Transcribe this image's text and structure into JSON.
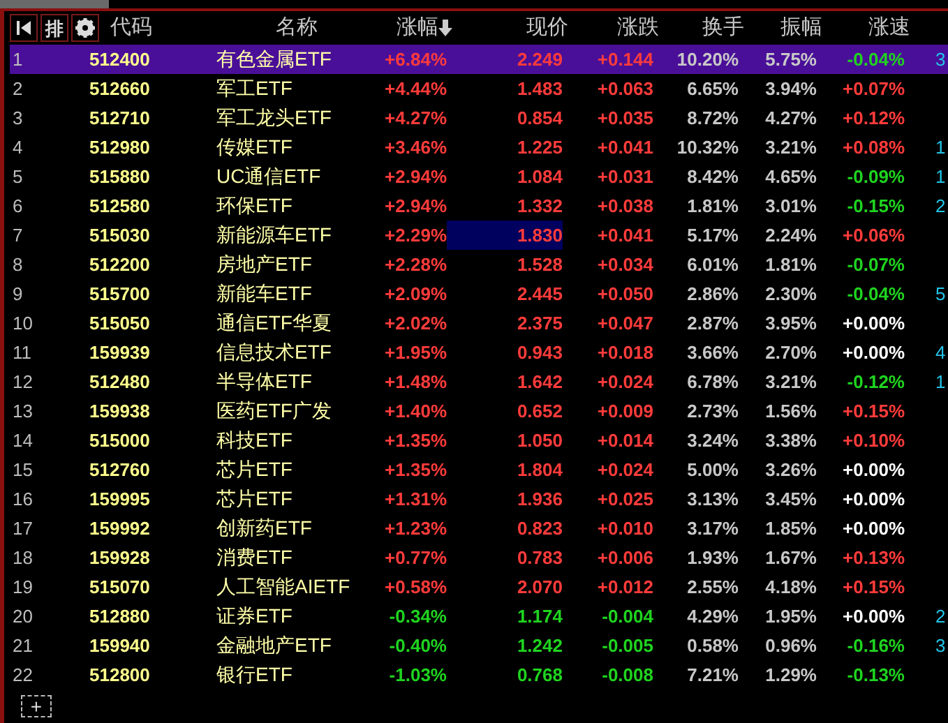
{
  "toolbar": {
    "sort_button": "排"
  },
  "columns": [
    {
      "label": "代码",
      "sorted_desc": false
    },
    {
      "label": "名称",
      "sorted_desc": false
    },
    {
      "label": "涨幅",
      "sorted_desc": true
    },
    {
      "label": "现价",
      "sorted_desc": false
    },
    {
      "label": "涨跌",
      "sorted_desc": false
    },
    {
      "label": "换手",
      "sorted_desc": false
    },
    {
      "label": "振幅",
      "sorted_desc": false
    },
    {
      "label": "涨速",
      "sorted_desc": false
    }
  ],
  "rows": [
    {
      "num": "1",
      "code": "512400",
      "name": "有色金属ETF",
      "pct": "+6.84%",
      "price": "2.249",
      "change": "+0.144",
      "turnover": "10.20%",
      "amplitude": "5.75%",
      "speed": "-0.04%",
      "rising": true,
      "speed_rising": false,
      "speed_falling": true,
      "column_9": "3",
      "selected": true,
      "price_focused": false
    },
    {
      "num": "2",
      "code": "512660",
      "name": "军工ETF",
      "pct": "+4.44%",
      "price": "1.483",
      "change": "+0.063",
      "turnover": "6.65%",
      "amplitude": "3.94%",
      "speed": "+0.07%",
      "rising": true,
      "speed_rising": true,
      "speed_falling": false,
      "selected": false,
      "price_focused": false
    },
    {
      "num": "3",
      "code": "512710",
      "name": "军工龙头ETF",
      "pct": "+4.27%",
      "price": "0.854",
      "change": "+0.035",
      "turnover": "8.72%",
      "amplitude": "4.27%",
      "speed": "+0.12%",
      "rising": true,
      "speed_rising": true,
      "speed_falling": false,
      "selected": false,
      "price_focused": false
    },
    {
      "num": "4",
      "code": "512980",
      "name": "传媒ETF",
      "pct": "+3.46%",
      "price": "1.225",
      "change": "+0.041",
      "turnover": "10.32%",
      "amplitude": "3.21%",
      "speed": "+0.08%",
      "rising": true,
      "speed_rising": true,
      "speed_falling": false,
      "column_9": "1",
      "selected": false,
      "price_focused": false
    },
    {
      "num": "5",
      "code": "515880",
      "name": "UC通信ETF",
      "pct": "+2.94%",
      "price": "1.084",
      "change": "+0.031",
      "turnover": "8.42%",
      "amplitude": "4.65%",
      "speed": "-0.09%",
      "rising": true,
      "speed_rising": false,
      "speed_falling": true,
      "column_9": "1",
      "selected": false,
      "price_focused": false
    },
    {
      "num": "6",
      "code": "512580",
      "name": "环保ETF",
      "pct": "+2.94%",
      "price": "1.332",
      "change": "+0.038",
      "turnover": "1.81%",
      "amplitude": "3.01%",
      "speed": "-0.15%",
      "rising": true,
      "speed_rising": false,
      "speed_falling": true,
      "column_9": "2",
      "selected": false,
      "price_focused": false
    },
    {
      "num": "7",
      "code": "515030",
      "name": "新能源车ETF",
      "pct": "+2.29%",
      "price": "1.830",
      "change": "+0.041",
      "turnover": "5.17%",
      "amplitude": "2.24%",
      "speed": "+0.06%",
      "rising": true,
      "speed_rising": true,
      "speed_falling": false,
      "selected": false,
      "price_focused": true
    },
    {
      "num": "8",
      "code": "512200",
      "name": "房地产ETF",
      "pct": "+2.28%",
      "price": "1.528",
      "change": "+0.034",
      "turnover": "6.01%",
      "amplitude": "1.81%",
      "speed": "-0.07%",
      "rising": true,
      "speed_rising": false,
      "speed_falling": true,
      "selected": false,
      "price_focused": false
    },
    {
      "num": "9",
      "code": "515700",
      "name": "新能车ETF",
      "pct": "+2.09%",
      "price": "2.445",
      "change": "+0.050",
      "turnover": "2.86%",
      "amplitude": "2.30%",
      "speed": "-0.04%",
      "rising": true,
      "speed_rising": false,
      "speed_falling": true,
      "column_9": "5",
      "selected": false,
      "price_focused": false
    },
    {
      "num": "10",
      "code": "515050",
      "name": "通信ETF华夏",
      "pct": "+2.02%",
      "price": "2.375",
      "change": "+0.047",
      "turnover": "2.87%",
      "amplitude": "3.95%",
      "speed": "+0.00%",
      "rising": true,
      "speed_rising": false,
      "speed_falling": false,
      "selected": false,
      "price_focused": false
    },
    {
      "num": "11",
      "code": "159939",
      "name": "信息技术ETF",
      "pct": "+1.95%",
      "price": "0.943",
      "change": "+0.018",
      "turnover": "3.66%",
      "amplitude": "2.70%",
      "speed": "+0.00%",
      "rising": true,
      "speed_rising": false,
      "speed_falling": false,
      "column_9": "4",
      "selected": false,
      "price_focused": false
    },
    {
      "num": "12",
      "code": "512480",
      "name": "半导体ETF",
      "pct": "+1.48%",
      "price": "1.642",
      "change": "+0.024",
      "turnover": "6.78%",
      "amplitude": "3.21%",
      "speed": "-0.12%",
      "rising": true,
      "speed_rising": false,
      "speed_falling": true,
      "column_9": "1",
      "selected": false,
      "price_focused": false
    },
    {
      "num": "13",
      "code": "159938",
      "name": "医药ETF广发",
      "pct": "+1.40%",
      "price": "0.652",
      "change": "+0.009",
      "turnover": "2.73%",
      "amplitude": "1.56%",
      "speed": "+0.15%",
      "rising": true,
      "speed_rising": true,
      "speed_falling": false,
      "selected": false,
      "price_focused": false
    },
    {
      "num": "14",
      "code": "515000",
      "name": "科技ETF",
      "pct": "+1.35%",
      "price": "1.050",
      "change": "+0.014",
      "turnover": "3.24%",
      "amplitude": "3.38%",
      "speed": "+0.10%",
      "rising": true,
      "speed_rising": true,
      "speed_falling": false,
      "selected": false,
      "price_focused": false
    },
    {
      "num": "15",
      "code": "512760",
      "name": "芯片ETF",
      "pct": "+1.35%",
      "price": "1.804",
      "change": "+0.024",
      "turnover": "5.00%",
      "amplitude": "3.26%",
      "speed": "+0.00%",
      "rising": true,
      "speed_rising": false,
      "speed_falling": false,
      "selected": false,
      "price_focused": false
    },
    {
      "num": "16",
      "code": "159995",
      "name": "芯片ETF",
      "pct": "+1.31%",
      "price": "1.936",
      "change": "+0.025",
      "turnover": "3.13%",
      "amplitude": "3.45%",
      "speed": "+0.00%",
      "rising": true,
      "speed_rising": false,
      "speed_falling": false,
      "selected": false,
      "price_focused": false
    },
    {
      "num": "17",
      "code": "159992",
      "name": "创新药ETF",
      "pct": "+1.23%",
      "price": "0.823",
      "change": "+0.010",
      "turnover": "3.17%",
      "amplitude": "1.85%",
      "speed": "+0.00%",
      "rising": true,
      "speed_rising": false,
      "speed_falling": false,
      "selected": false,
      "price_focused": false
    },
    {
      "num": "18",
      "code": "159928",
      "name": "消费ETF",
      "pct": "+0.77%",
      "price": "0.783",
      "change": "+0.006",
      "turnover": "1.93%",
      "amplitude": "1.67%",
      "speed": "+0.13%",
      "rising": true,
      "speed_rising": true,
      "speed_falling": false,
      "selected": false,
      "price_focused": false
    },
    {
      "num": "19",
      "code": "515070",
      "name": "人工智能AIETF",
      "pct": "+0.58%",
      "price": "2.070",
      "change": "+0.012",
      "turnover": "2.55%",
      "amplitude": "4.18%",
      "speed": "+0.15%",
      "rising": true,
      "speed_rising": true,
      "speed_falling": false,
      "selected": false,
      "price_focused": false
    },
    {
      "num": "20",
      "code": "512880",
      "name": "证券ETF",
      "pct": "-0.34%",
      "price": "1.174",
      "change": "-0.004",
      "turnover": "4.29%",
      "amplitude": "1.95%",
      "speed": "+0.00%",
      "rising": false,
      "speed_rising": false,
      "speed_falling": false,
      "column_9": "2",
      "selected": false,
      "price_focused": false
    },
    {
      "num": "21",
      "code": "159940",
      "name": "金融地产ETF",
      "pct": "-0.40%",
      "price": "1.242",
      "change": "-0.005",
      "turnover": "0.58%",
      "amplitude": "0.96%",
      "speed": "-0.16%",
      "rising": false,
      "speed_rising": false,
      "speed_falling": true,
      "column_9": "3",
      "selected": false,
      "price_focused": false
    },
    {
      "num": "22",
      "code": "512800",
      "name": "银行ETF",
      "pct": "-1.03%",
      "price": "0.768",
      "change": "-0.008",
      "turnover": "7.21%",
      "amplitude": "1.29%",
      "speed": "-0.13%",
      "rising": false,
      "speed_rising": false,
      "speed_falling": true,
      "selected": false,
      "price_focused": false
    }
  ],
  "add_button": "+"
}
